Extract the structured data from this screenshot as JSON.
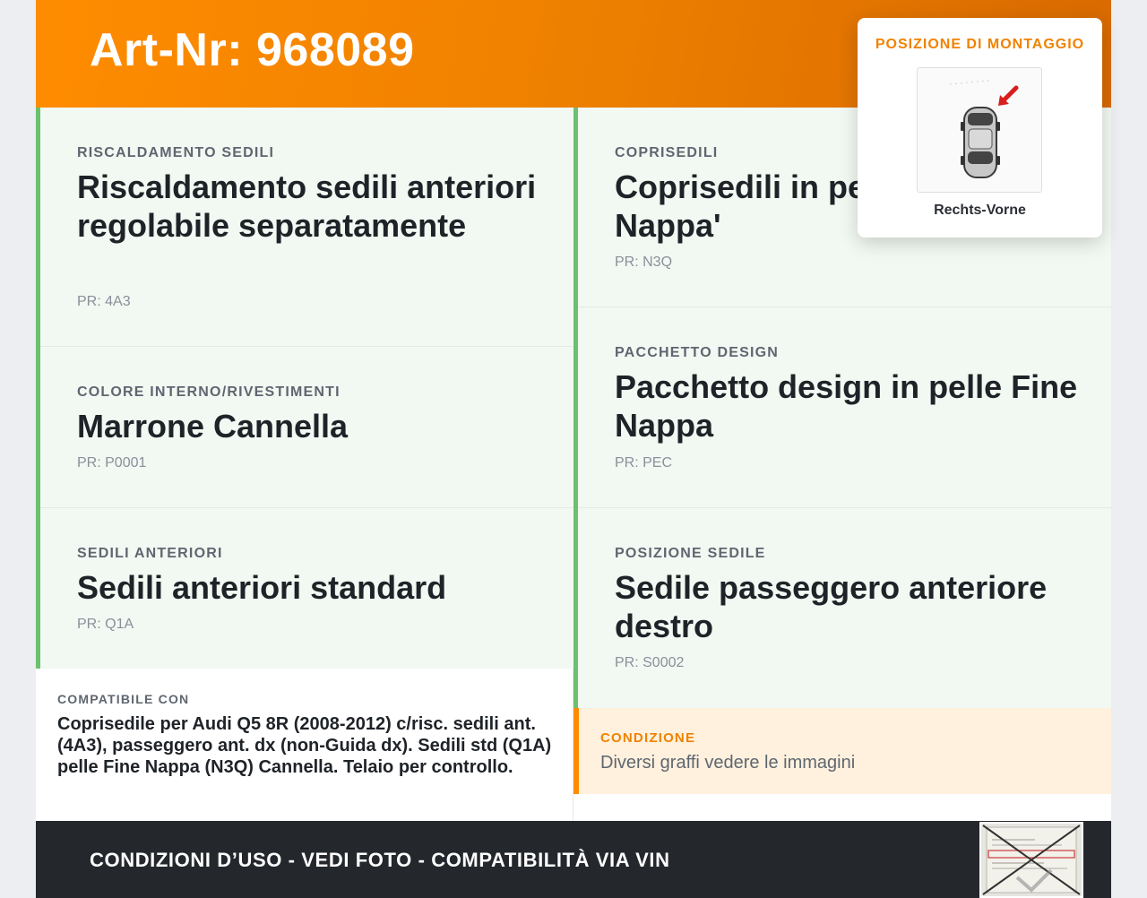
{
  "header": {
    "title": "Art-Nr: 968089"
  },
  "left_cards": [
    {
      "label": "RISCALDAMENTO SEDILI",
      "value": "Riscaldamento sedili anteriori regolabile separatamente",
      "pr": "PR: 4A3"
    },
    {
      "label": "COLORE INTERNO/RIVESTIMENTI",
      "value": "Marrone Cannella",
      "pr": "PR: P0001"
    },
    {
      "label": "SEDILI ANTERIORI",
      "value": "Sedili anteriori standard",
      "pr": "PR: Q1A"
    }
  ],
  "right_cards": [
    {
      "label": "COPRISEDILI",
      "value": "Coprisedili in pelle Fine Nappa'",
      "pr": "PR: N3Q"
    },
    {
      "label": "PACCHETTO DESIGN",
      "value": "Pacchetto design in pelle Fine Nappa",
      "pr": "PR: PEC"
    },
    {
      "label": "POSIZIONE SEDILE",
      "value": "Sedile passeggero anteriore destro",
      "pr": "PR: S0002"
    }
  ],
  "compat": {
    "label": "COMPATIBILE CON",
    "text": "Coprisedile per Audi Q5 8R (2008-2012) c/risc. sedili ant. (4A3), passeggero ant. dx (non-Guida dx). Sedili std (Q1A) pelle Fine Nappa (N3Q) Cannella. Telaio per controllo."
  },
  "condition": {
    "label": "CONDIZIONE",
    "text": "Diversi graffi vedere le immagini"
  },
  "footer": {
    "text": "CONDIZIONI D’USO - VEDI FOTO - COMPATIBILITÀ VIA VIN"
  },
  "popup": {
    "label": "POSIZIONE DI MONTAGGIO",
    "caption": "Rechts-Vorne",
    "image_icon": "car-top-view-with-arrow"
  },
  "colors": {
    "accent": "#ff8c00",
    "card_border": "#6cc070",
    "card_bg": "#f2f8f2",
    "footer_bg": "#24272c",
    "condition_bg": "#fff1de"
  }
}
